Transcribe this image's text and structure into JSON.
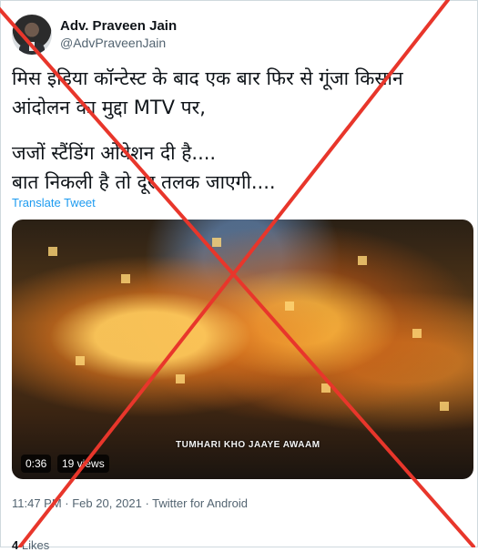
{
  "author": {
    "name": "Adv. Praveen Jain",
    "handle": "@AdvPraveenJain"
  },
  "tweet": {
    "lines": [
      "मिस इंडिया कॉन्टेस्ट के बाद एक बार फिर से गूंजा किसान",
      "आंदोलन का मुद्दा MTV पर,",
      "जजों स्टैंडिंग ओवेशन दी है....",
      "बात निकली है तो दूर तलक जाएगी...."
    ],
    "translate_label": "Translate Tweet"
  },
  "video": {
    "caption": "TUMHARI KHO JAAYE AWAAM",
    "duration": "0:36",
    "views": "19 views"
  },
  "meta": {
    "timestamp": "11:47 PM · Feb 20, 2021 · Twitter for Android"
  },
  "stats": {
    "likes_count": "4",
    "likes_label": "Likes"
  },
  "overlay": {
    "cross_color": "#e8362b"
  }
}
